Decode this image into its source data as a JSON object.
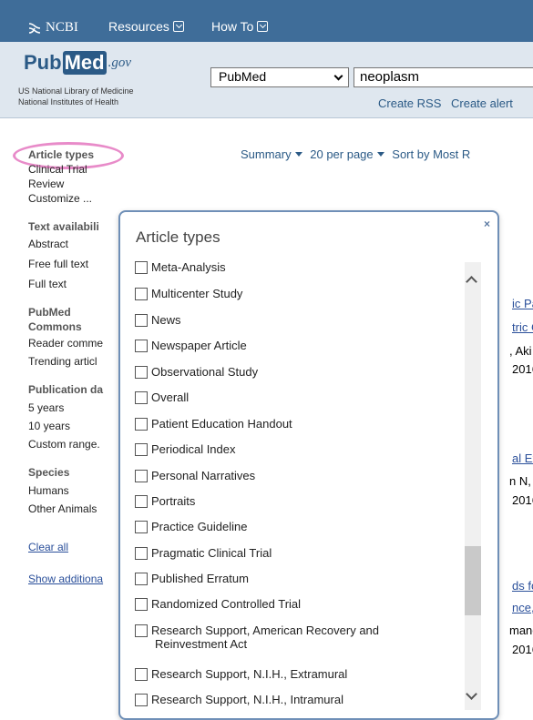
{
  "ncbi_bar": {
    "logo_text": "NCBI",
    "resources_label": "Resources",
    "howto_label": "How To"
  },
  "header": {
    "logo_pub": "Pub",
    "logo_med": "Med",
    "logo_gov": ".gov",
    "sub_line1": "US National Library of Medicine",
    "sub_line2": "National Institutes of Health",
    "database_selected": "PubMed",
    "search_value": "neoplasm",
    "create_rss": "Create RSS",
    "create_alert": "Create alert"
  },
  "sidebar": {
    "article_types": "Article types",
    "clinical_trial": "Clinical Trial",
    "review": "Review",
    "customize": "Customize ...",
    "text_availability": "Text availabili",
    "abstract": "Abstract",
    "free_full_text": "Free full text",
    "full_text": "Full text",
    "pubmed": "PubMed",
    "commons": "Commons",
    "reader_comments": "Reader comme",
    "trending_articles": "Trending articl",
    "publication_dates": "Publication da",
    "five_years": "5 years",
    "ten_years": "10 years",
    "custom_range": "Custom range.",
    "species": "Species",
    "humans": "Humans",
    "other_animals": "Other Animals",
    "clear_all": "Clear all",
    "show_additional": "Show additiona"
  },
  "result_bar": {
    "summary": "Summary",
    "per_page": "20 per page",
    "sort_by": "Sort by Most R"
  },
  "background_fragments": {
    "f1": "ic Pa",
    "f2": "tric C",
    "f3": ", Aki",
    "f4": "2016",
    "f5": "al Ex",
    "f6": "n N,",
    "f7": "2016",
    "f8": "ds fo",
    "f9": "nce,",
    "f10": "mane",
    "f11": "2016"
  },
  "popup": {
    "title": "Article types",
    "close": "×",
    "options": [
      "Meta-Analysis",
      "Multicenter Study",
      "News",
      "Newspaper Article",
      "Observational Study",
      "Overall",
      "Patient Education Handout",
      "Periodical Index",
      "Personal Narratives",
      "Portraits",
      "Practice Guideline",
      "Pragmatic Clinical Trial",
      "Published Erratum",
      "Randomized Controlled Trial",
      "Research Support, American Recovery and Reinvestment Act",
      "Research Support, N.I.H., Extramural",
      "Research Support, N.I.H., Intramural"
    ],
    "option_two_line_1": "Research Support, American Recovery and",
    "option_two_line_2": "Reinvestment Act"
  }
}
